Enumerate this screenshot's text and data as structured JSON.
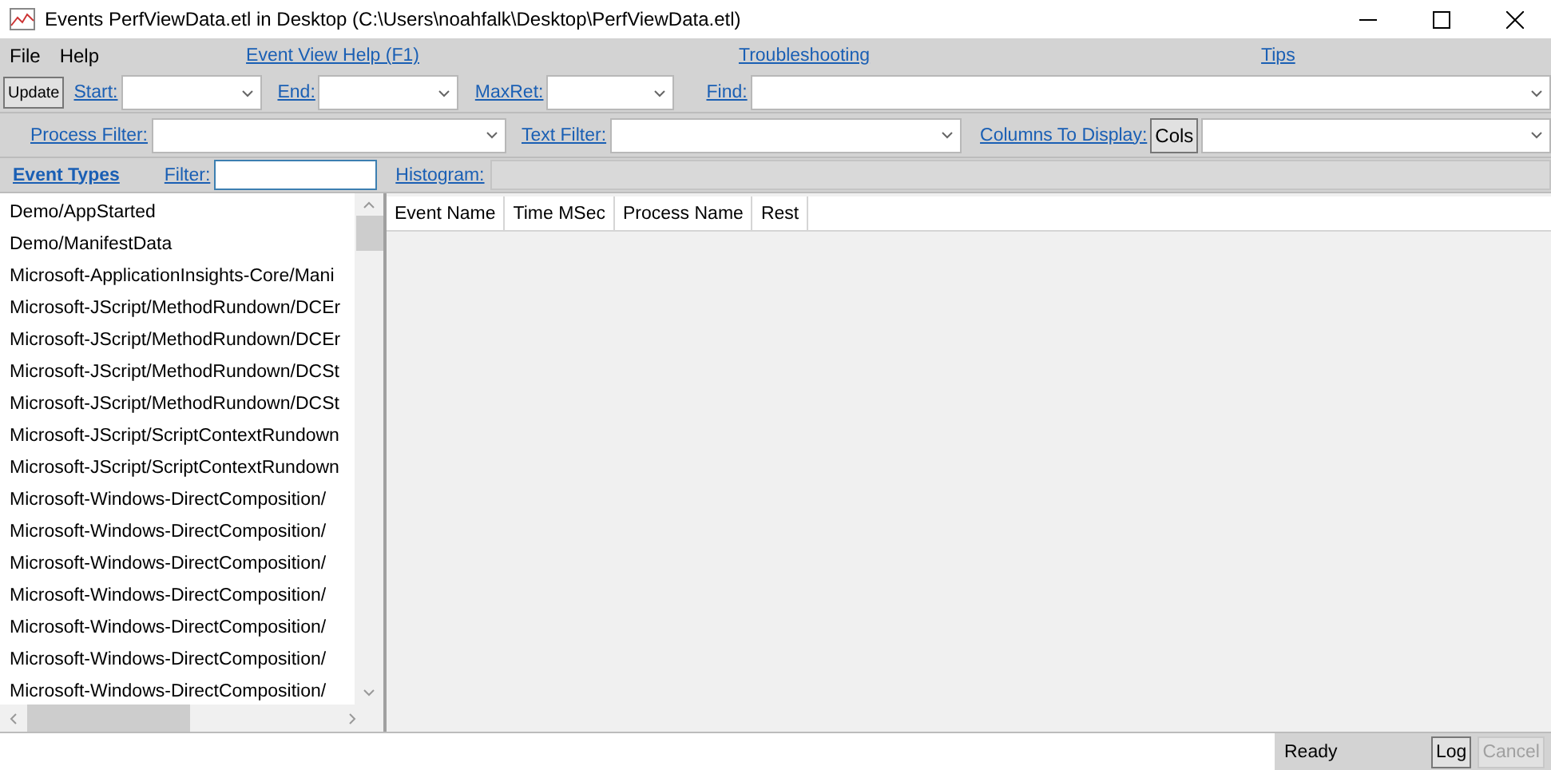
{
  "window": {
    "title": "Events PerfViewData.etl in Desktop (C:\\Users\\noahfalk\\Desktop\\PerfViewData.etl)"
  },
  "menu": [
    "File",
    "Help"
  ],
  "help_links": [
    "Event View Help (F1)",
    "Troubleshooting",
    "Tips"
  ],
  "update_button": "Update",
  "range_fields": [
    {
      "label": "Start:"
    },
    {
      "label": "End:"
    },
    {
      "label": "MaxRet:"
    }
  ],
  "find": {
    "label": "Find:"
  },
  "process_filter": {
    "label": "Process Filter:"
  },
  "text_filter": {
    "label": "Text Filter:"
  },
  "columns_to_display": {
    "label": "Columns To Display:",
    "button": "Cols"
  },
  "event_types": {
    "title": "Event Types",
    "filter_label": "Filter:",
    "items": [
      "Demo/AppStarted",
      "Demo/ManifestData",
      "Microsoft-ApplicationInsights-Core/Mani",
      "Microsoft-JScript/MethodRundown/DCEr",
      "Microsoft-JScript/MethodRundown/DCEr",
      "Microsoft-JScript/MethodRundown/DCSt",
      "Microsoft-JScript/MethodRundown/DCSt",
      "Microsoft-JScript/ScriptContextRundown",
      "Microsoft-JScript/ScriptContextRundown",
      "Microsoft-Windows-DirectComposition/",
      "Microsoft-Windows-DirectComposition/",
      "Microsoft-Windows-DirectComposition/",
      "Microsoft-Windows-DirectComposition/",
      "Microsoft-Windows-DirectComposition/",
      "Microsoft-Windows-DirectComposition/",
      "Microsoft-Windows-DirectComposition/"
    ]
  },
  "histogram": {
    "label": "Histogram:"
  },
  "table": {
    "columns": [
      "Event Name",
      "Time MSec",
      "Process Name",
      "Rest"
    ]
  },
  "status_bar": {
    "status": "Ready",
    "buttons": [
      {
        "label": "Log",
        "disabled": false
      },
      {
        "label": "Cancel",
        "disabled": true
      }
    ]
  }
}
